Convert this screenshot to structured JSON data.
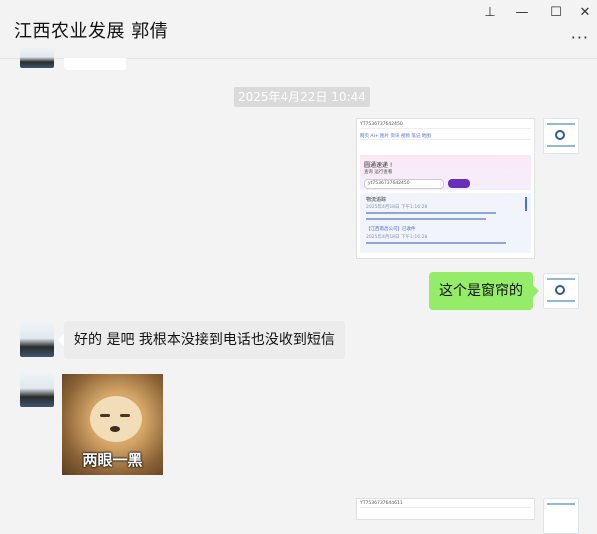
{
  "window": {
    "title": "江西农业发展 郭倩",
    "pin_glyph": "⊥",
    "minimize_glyph": "—",
    "maximize_glyph": "☐",
    "close_glyph": "✕",
    "more_glyph": "···"
  },
  "messages": {
    "timestamp": "2025年4月22日 10:44",
    "screenshot1": {
      "url_text": "YT7536737642450",
      "tab_text": "网页   AI+   图片   资讯   视频   笔记   地图",
      "hero_title": "圆通速递 !",
      "hero_sub": "查询 运行查看",
      "search_text": "yt7536737642450",
      "card_title": "物流追踪",
      "card_line1": "2025年4月18日 下午1:16:28",
      "card_line2": "【江西南昌公司】已收件",
      "card_line3": "2025年4月18日 下午1:16:28"
    },
    "outgoing_text": "这个是窗帘的",
    "incoming_text": "好的 是吧 我根本没接到电话也没收到短信",
    "sticker_text": "两眼一黑",
    "screenshot2": {
      "url_text": "YT7536737644611"
    }
  },
  "colors": {
    "bubble_green": "#95ec69",
    "bubble_white": "#ffffff",
    "background": "#f3f3f3",
    "timestamp_bg": "#dadada"
  }
}
